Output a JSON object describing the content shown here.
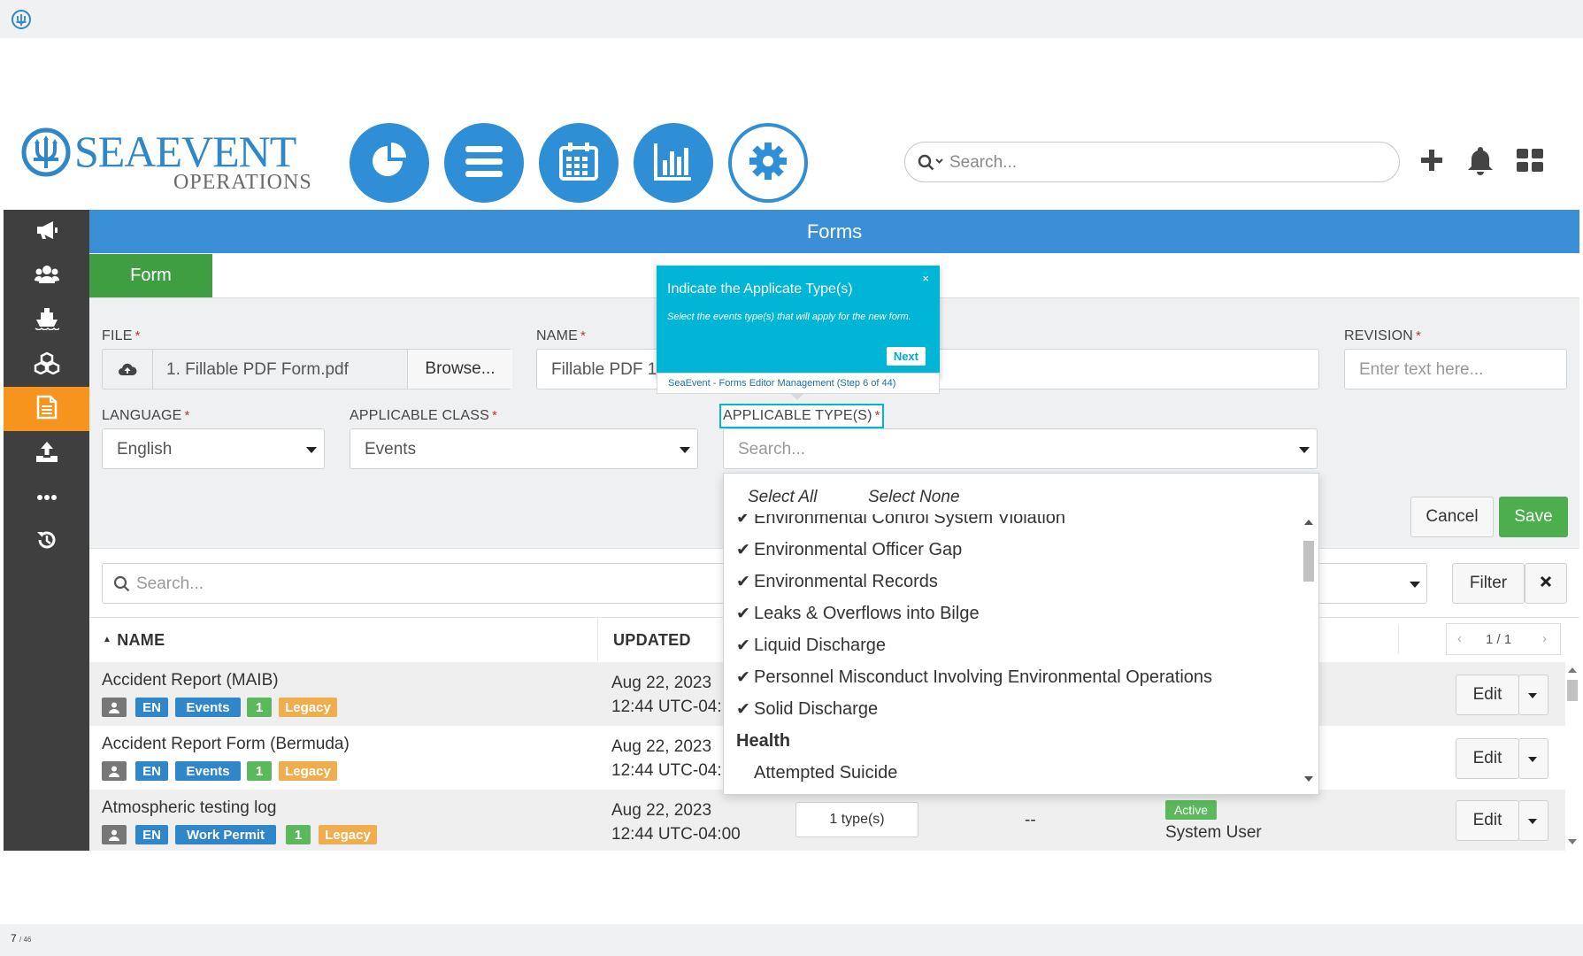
{
  "footer": {
    "page_current": "7",
    "page_total": "/ 46"
  },
  "brand": {
    "name_primary": "SEAEVENT",
    "name_secondary": "OPERATIONS"
  },
  "header": {
    "nav_icons": [
      "pie-chart-icon",
      "menu-icon",
      "calendar-icon",
      "bar-chart-icon",
      "gear-icon"
    ],
    "search_placeholder": "Search...",
    "action_icons": [
      "plus-icon",
      "bell-icon",
      "grid-icon"
    ]
  },
  "sidebar": {
    "icons": [
      "megaphone-icon",
      "users-icon",
      "ship-icon",
      "cubes-icon",
      "document-icon",
      "upload-icon",
      "more-icon",
      "history-icon"
    ],
    "active_index": 4
  },
  "page": {
    "title": "Forms",
    "tab": "Form"
  },
  "form": {
    "file_label": "FILE",
    "file_value": "1. Fillable PDF Form.pdf",
    "browse_label": "Browse...",
    "name_label": "NAME",
    "name_value": "Fillable PDF 1",
    "revision_label": "REVISION",
    "revision_placeholder": "Enter text here...",
    "language_label": "LANGUAGE",
    "language_value": "English",
    "class_label": "APPLICABLE CLASS",
    "class_value": "Events",
    "types_label": "APPLICABLE TYPE(S)",
    "types_placeholder": "Search...",
    "cancel_label": "Cancel",
    "save_label": "Save",
    "required_mark": "*"
  },
  "dropdown": {
    "select_all": "Select All",
    "select_none": "Select None",
    "items": [
      {
        "label": "Environmental Control System Violation",
        "checked": true
      },
      {
        "label": "Environmental Officer Gap",
        "checked": true
      },
      {
        "label": "Environmental Records",
        "checked": true
      },
      {
        "label": "Leaks & Overflows into Bilge",
        "checked": true
      },
      {
        "label": "Liquid Discharge",
        "checked": true
      },
      {
        "label": "Personnel Misconduct Involving Environmental Operations",
        "checked": true
      },
      {
        "label": "Solid Discharge",
        "checked": true
      }
    ],
    "group": "Health",
    "group_first_item": "Attempted Suicide"
  },
  "tour": {
    "title": "Indicate the Applicate Type(s)",
    "body": "Select the events type(s) that will apply for the new form.",
    "close": "×",
    "next": "Next",
    "footer": "SeaEvent - Forms Editor Management (Step 6 of 44)"
  },
  "list": {
    "search_placeholder": "Search...",
    "filter_label": "Filter",
    "col_name": "NAME",
    "col_updated": "UPDATED",
    "pager": "1 / 1",
    "edit_label": "Edit",
    "rows": [
      {
        "name": "Accident Report (MAIB)",
        "date": "Aug 22, 2023",
        "time": "12:44 UTC-04:",
        "tags": [
          "EN",
          "Events",
          "1",
          "Legacy"
        ]
      },
      {
        "name": "Accident Report Form (Bermuda)",
        "date": "Aug 22, 2023",
        "time": "12:44 UTC-04:",
        "tags": [
          "EN",
          "Events",
          "1",
          "Legacy"
        ]
      },
      {
        "name": "Atmospheric testing log",
        "date": "Aug 22, 2023",
        "time": "12:44 UTC-04:00",
        "tags": [
          "EN",
          "Work Permit",
          "1",
          "Legacy"
        ],
        "types": "1 type(s)",
        "dash": "--",
        "status": "Active",
        "user": "System User"
      }
    ]
  },
  "colors": {
    "brand_blue": "#2f8fd6",
    "title_bar": "#3b8fd6",
    "tab_green": "#3f9e42",
    "sidebar": "#3f3f3f",
    "active_orange": "#f7941d",
    "tour_cyan": "#00b5d6"
  }
}
